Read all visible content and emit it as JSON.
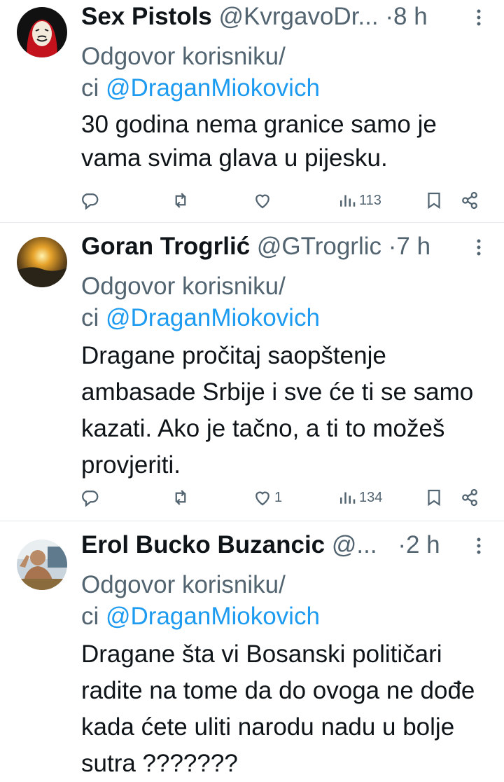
{
  "tweets": [
    {
      "name": "Sex Pistols",
      "handle": "@KvrgavoDr...",
      "time": "8 h",
      "reply_prefix": "Odgovor korisniku/",
      "reply_line2": "ci ",
      "reply_to": "@DraganMiokovich",
      "text": "30 godina nema granice samo je vama svima glava u pijesku.",
      "likes": "",
      "views": "113"
    },
    {
      "name": "Goran Trogrlić",
      "handle": "@GTrogrlic",
      "time": "7 h",
      "reply_prefix": "Odgovor korisniku/",
      "reply_line2": "ci ",
      "reply_to": "@DraganMiokovich",
      "text": "Dragane pročitaj saopštenje ambasade Srbije i sve će ti se samo kazati. Ako je tačno, a ti to možeš provjeriti.",
      "likes": "1",
      "views": "134"
    },
    {
      "name": "Erol Bucko Buzancic",
      "handle": "@...",
      "time": "2 h",
      "reply_prefix": "Odgovor korisniku/",
      "reply_line2": "ci ",
      "reply_to": "@DraganMiokovich",
      "text": "Dragane šta vi Bosanski političari radite na tome da do ovoga ne dođe kada ćete uliti narodu nadu u bolje sutra ???????",
      "likes": "",
      "views": ""
    }
  ],
  "dot": "·",
  "icons": [
    "reply-icon",
    "retweet-icon",
    "like-icon",
    "views-icon",
    "bookmark-icon",
    "share-icon",
    "more-icon"
  ],
  "colors": {
    "link": "#1d9bf0",
    "muted": "#536471",
    "text": "#0f1419"
  }
}
